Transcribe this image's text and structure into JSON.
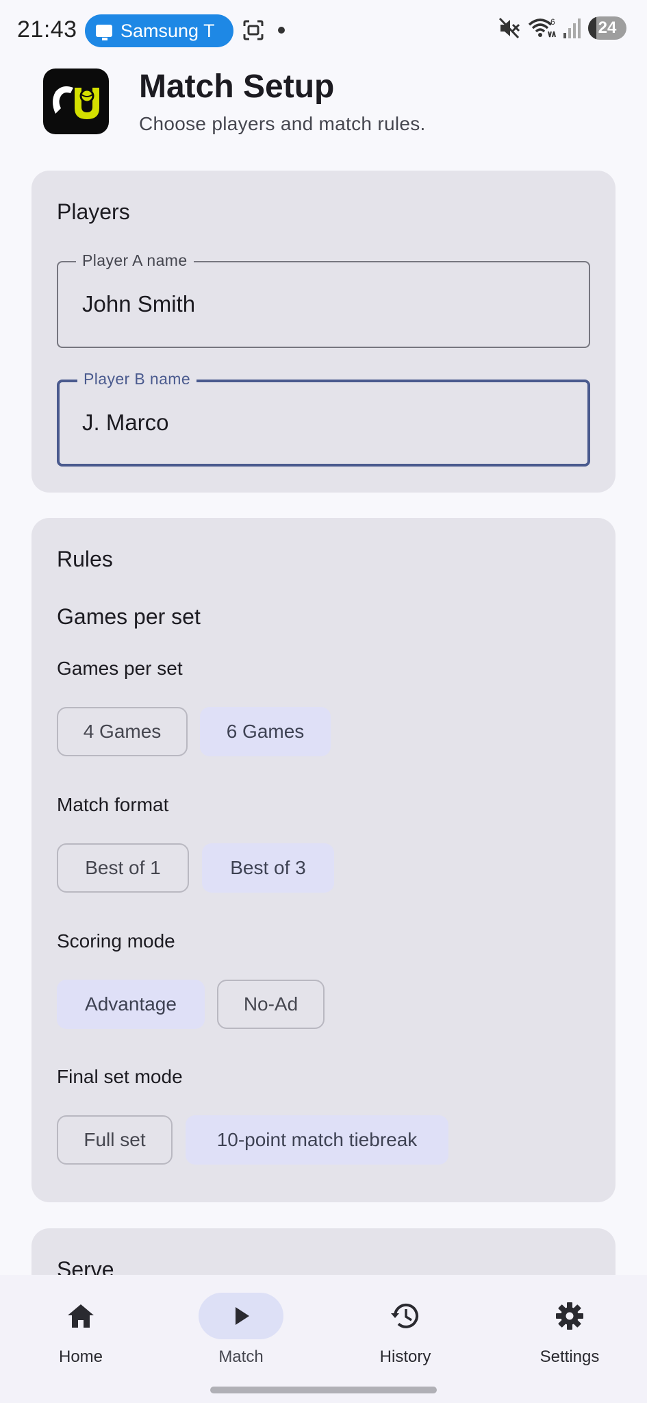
{
  "status_bar": {
    "time": "21:43",
    "cast_label": "Samsung T",
    "icons": [
      "cast-tv-icon",
      "screen-record-icon",
      "notification-dot-icon",
      "mute-icon",
      "wifi-icon",
      "signal-icon"
    ],
    "wifi_badge": "6",
    "battery": "24"
  },
  "header": {
    "logo_icon": "tennis-app-logo",
    "title": "Match Setup",
    "subtitle": "Choose players and match rules."
  },
  "players": {
    "title": "Players",
    "player_a": {
      "label": "Player A name",
      "value": "John Smith"
    },
    "player_b": {
      "label": "Player B name",
      "value": "J. Marco"
    }
  },
  "rules": {
    "title": "Rules",
    "section_heading": "Games per set",
    "games_per_set": {
      "label": "Games per set",
      "options": [
        "4 Games",
        "6 Games"
      ],
      "selected": "6 Games"
    },
    "match_format": {
      "label": "Match format",
      "options": [
        "Best of 1",
        "Best of 3"
      ],
      "selected": "Best of 3"
    },
    "scoring_mode": {
      "label": "Scoring mode",
      "options": [
        "Advantage",
        "No-Ad"
      ],
      "selected": "Advantage"
    },
    "final_set_mode": {
      "label": "Final set mode",
      "options": [
        "Full set",
        "10-point match tiebreak"
      ],
      "selected": "10-point match tiebreak"
    }
  },
  "serve": {
    "title": "Serve"
  },
  "bottom_nav": {
    "items": [
      {
        "label": "Home",
        "icon": "home-icon"
      },
      {
        "label": "Match",
        "icon": "play-icon",
        "active": true
      },
      {
        "label": "History",
        "icon": "history-icon"
      },
      {
        "label": "Settings",
        "icon": "gear-icon"
      }
    ]
  },
  "colors": {
    "primary_outline": "#4a5a8e",
    "selected_chip": "#dfe0f7",
    "card_bg": "#e4e3ea",
    "cast_pill": "#1e88e5",
    "logo_accent": "#d4e000"
  }
}
